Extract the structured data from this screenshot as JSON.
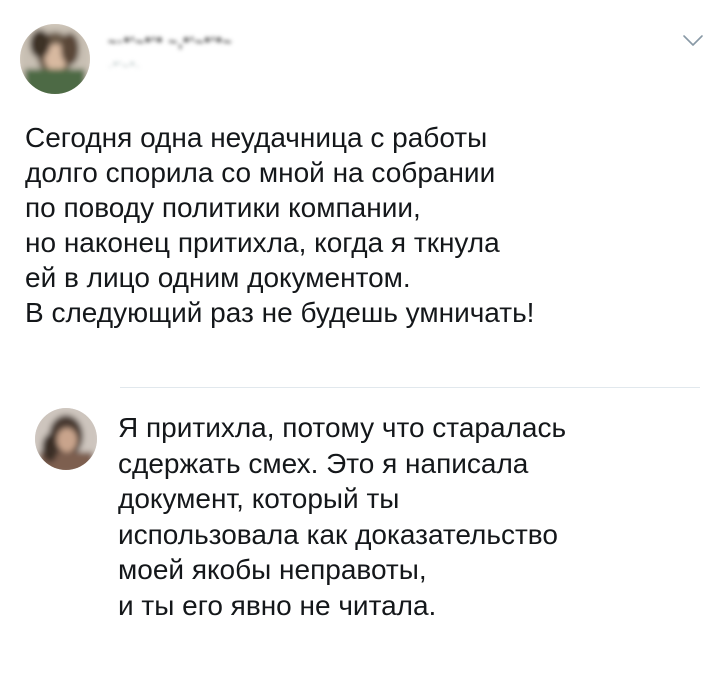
{
  "tweet": {
    "author_name": "~·*'~*'* ~,*'~*'*~",
    "author_handle": "·*'~*·",
    "avatar_icon": "avatar-photo",
    "menu_icon": "chevron-down-icon",
    "text": "Сегодня одна неудачница с работы\nдолго спорила со мной на собрании\nпо поводу политики компании,\nно наконец притихла, когда я ткнула\nей в лицо одним документом.\nВ следующий раз не будешь умничать!"
  },
  "reply": {
    "avatar_icon": "avatar-photo",
    "text": "Я притихла, потому что старалась\nсдержать смех. Это я написала\nдокумент, который ты\nиспользовала как доказательство\nмоей якобы неправоты,\nи ты его явно не читала."
  },
  "colors": {
    "text": "#14171a",
    "divider": "#e1e8ed",
    "chevron": "#8899a6"
  }
}
